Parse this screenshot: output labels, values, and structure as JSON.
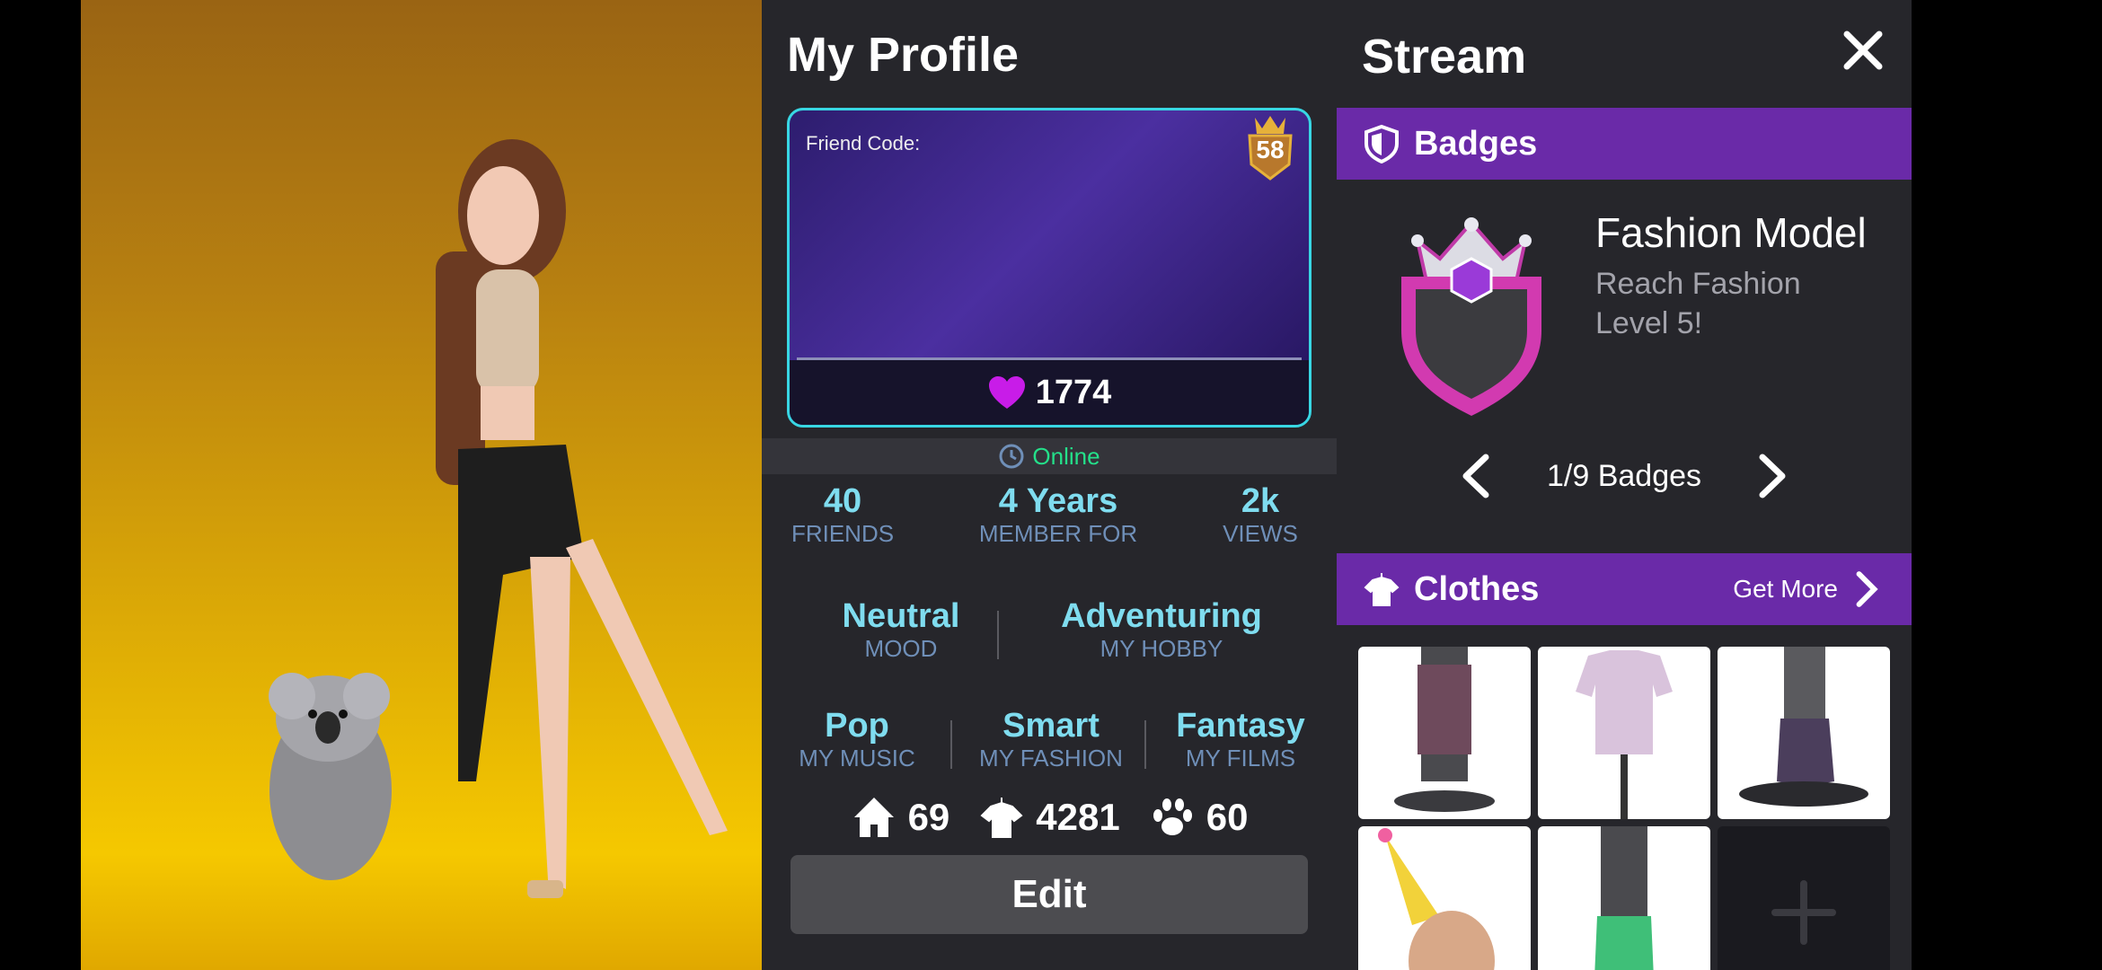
{
  "profile": {
    "title": "My Profile",
    "friend_code_label": "Friend Code:",
    "level": "58",
    "likes": "1774",
    "status": "Online",
    "stats": [
      {
        "value": "40",
        "label": "FRIENDS"
      },
      {
        "value": "4 Years",
        "label": "MEMBER FOR"
      },
      {
        "value": "2k",
        "label": "VIEWS"
      }
    ],
    "traits_row1": [
      {
        "value": "Neutral",
        "label": "MOOD"
      },
      {
        "value": "Adventuring",
        "label": "MY HOBBY"
      }
    ],
    "traits_row2": [
      {
        "value": "Pop",
        "label": "MY MUSIC"
      },
      {
        "value": "Smart",
        "label": "MY FASHION"
      },
      {
        "value": "Fantasy",
        "label": "MY FILMS"
      }
    ],
    "counts": {
      "homes": "69",
      "clothes": "4281",
      "pets": "60"
    },
    "edit_label": "Edit"
  },
  "stream": {
    "title": "Stream",
    "badges_header": "Badges",
    "badge": {
      "name": "Fashion Model",
      "description": "Reach Fashion Level 5!"
    },
    "pager": "1/9 Badges",
    "clothes_header": "Clothes",
    "get_more": "Get More",
    "add_symbol": "+"
  },
  "colors": {
    "accent_purple": "#6a2aa8",
    "stat_cyan": "#7fdcef",
    "online_green": "#24e08a",
    "heart": "#c81ce8"
  }
}
